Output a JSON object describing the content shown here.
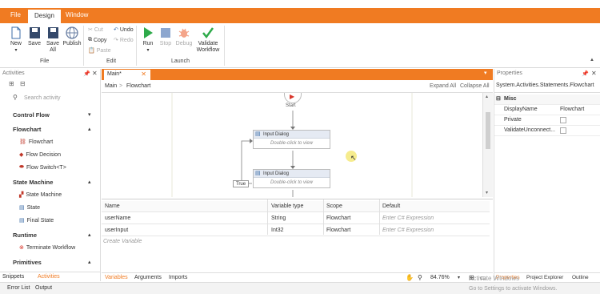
{
  "menu": {
    "tabs": [
      "File",
      "Design",
      "Window"
    ],
    "active": "Design"
  },
  "ribbon": {
    "new": "New",
    "save": "Save",
    "save_all": "Save\nAll",
    "publish": "Publish",
    "file_group": "File",
    "cut": "Cut",
    "copy": "Copy",
    "paste": "Paste",
    "undo": "Undo",
    "redo": "Redo",
    "edit_group": "Edit",
    "run": "Run",
    "stop": "Stop",
    "debug": "Debug",
    "validate": "Validate\nWorkflow",
    "launch_group": "Launch"
  },
  "activities": {
    "title": "Activities",
    "search_placeholder": "Search activity",
    "sections": {
      "control_flow": "Control Flow",
      "flowchart": "Flowchart",
      "state_machine": "State Machine",
      "runtime": "Runtime",
      "primitives": "Primitives"
    },
    "items": {
      "flowchart": "Flowchart",
      "flow_decision": "Flow Decision",
      "flow_switch": "Flow Switch<T>",
      "state_machine": "State Machine",
      "state": "State",
      "final_state": "Final State",
      "terminate_workflow": "Terminate Workflow"
    },
    "bottom_tabs": [
      "Snippets",
      "Activities"
    ]
  },
  "designer": {
    "tab": "Main*",
    "breadcrumb": [
      "Main",
      "Flowchart"
    ],
    "expand_all": "Expand All",
    "collapse_all": "Collapse All",
    "start_label": "Start",
    "activities": [
      {
        "title": "Input Dialog",
        "hint": "Double-click to view"
      },
      {
        "title": "Input Dialog",
        "hint": "Double-click to view"
      }
    ],
    "true_label": "True"
  },
  "variables": {
    "headers": [
      "Name",
      "Variable type",
      "Scope",
      "Default"
    ],
    "rows": [
      {
        "name": "userName",
        "type": "String",
        "scope": "Flowchart",
        "default": "Enter C# Expression"
      },
      {
        "name": "userInput",
        "type": "Int32",
        "scope": "Flowchart",
        "default": "Enter C# Expression"
      }
    ],
    "create_label": "Create Variable",
    "tabs": [
      "Variables",
      "Arguments",
      "Imports"
    ],
    "zoom": "84.76%"
  },
  "properties": {
    "title": "Properties",
    "type_name": "System.Activities.Statements.Flowchart",
    "category": "Misc",
    "rows": [
      {
        "label": "DisplayName",
        "value": "Flowchart"
      },
      {
        "label": "Private",
        "value": ""
      },
      {
        "label": "ValidateUnconnect...",
        "value": ""
      }
    ],
    "bottom_tabs": [
      "Properties",
      "Project Explorer",
      "Outline"
    ]
  },
  "status": {
    "tabs": [
      "Error List",
      "Output"
    ],
    "activate_title": "Activate Windows",
    "activate_sub": "Go to Settings to activate Windows."
  },
  "colors": {
    "accent": "#f07b22",
    "run_green": "#2eaa4a",
    "stop_blue": "#8da7cf",
    "start_red": "#d9362b"
  }
}
